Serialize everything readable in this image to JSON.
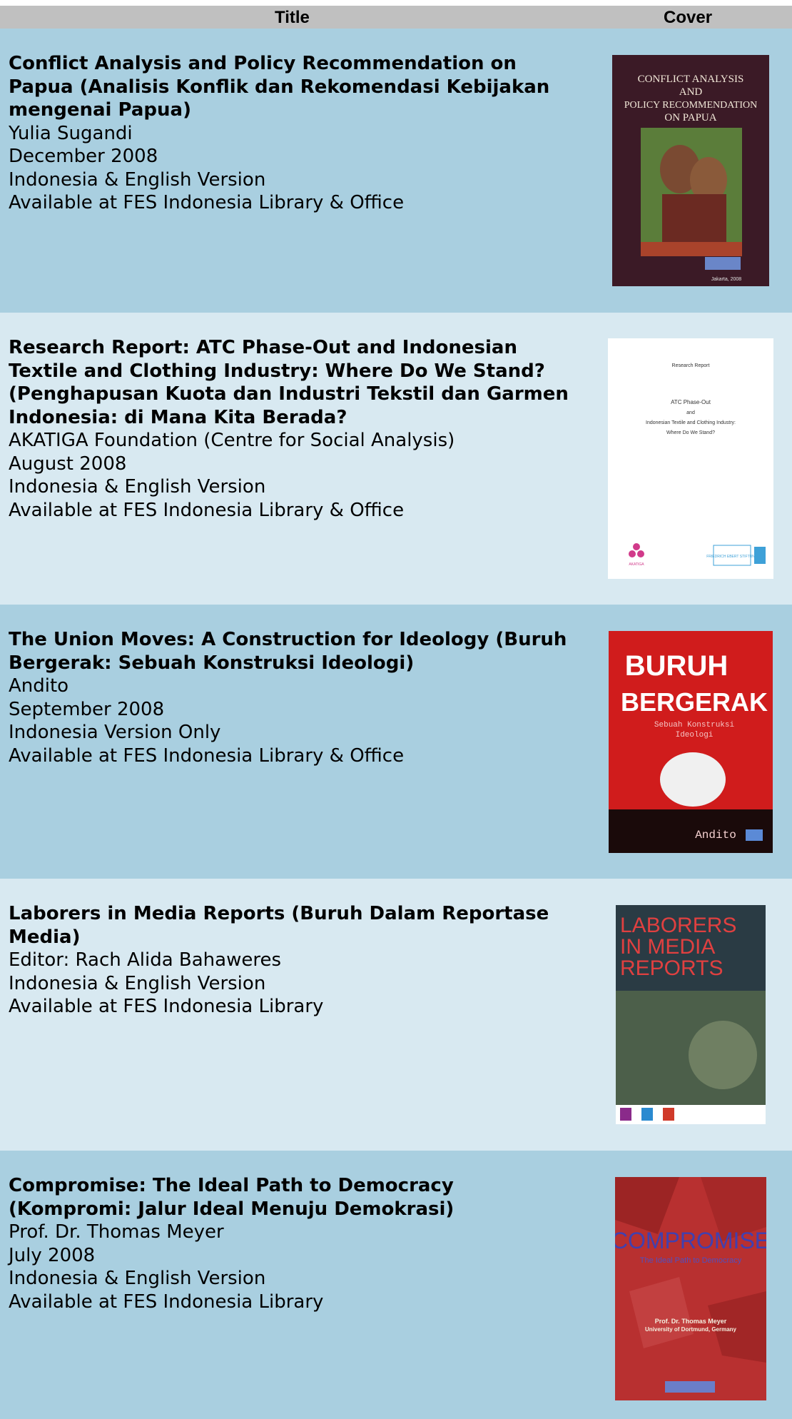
{
  "header": {
    "title": "Title",
    "cover": "Cover"
  },
  "books": [
    {
      "title": "Conflict Analysis and Policy Recommendation on Papua (Analisis Konflik dan Rekomendasi Kebijakan mengenai Papua)",
      "lines": [
        "Yulia Sugandi",
        "December 2008",
        "Indonesia & English Version",
        "Available at FES Indonesia Library & Office"
      ],
      "cover": {
        "line1": "CONFLICT ANALYSIS",
        "line2": "AND",
        "line3": "POLICY RECOMMENDATION",
        "line4": "ON PAPUA",
        "footer": "Jakarta, 2008"
      }
    },
    {
      "title": "Research Report: ATC Phase-Out and Indonesian Textile and Clothing Industry: Where Do We Stand? (Penghapusan Kuota dan Industri Tekstil dan Garmen Indonesia: di Mana Kita Berada?",
      "lines": [
        "AKATIGA Foundation (Centre for Social Analysis)",
        "August 2008",
        "Indonesia & English Version",
        "Available at FES Indonesia Library & Office"
      ],
      "cover": {
        "line1": "Research Report",
        "line2": "ATC Phase-Out",
        "line3": "and",
        "line4": "Indonesian Textile and Clothing Industry:",
        "line5": "Where Do We Stand?",
        "left_logo": "AKATIGA",
        "right_logo": "FRIEDRICH EBERT STIFTUNG"
      }
    },
    {
      "title": "The Union Moves: A Construction for Ideology (Buruh Bergerak: Sebuah Konstruksi Ideologi)",
      "lines": [
        "Andito",
        "September 2008",
        "Indonesia Version Only",
        "Available at FES Indonesia Library & Office"
      ],
      "cover": {
        "line1": "BURUH",
        "line2": "BERGERAK",
        "line3": "Sebuah Konstruksi",
        "line4": "Ideologi",
        "author": "Andito"
      }
    },
    {
      "title": "Laborers in Media Reports (Buruh Dalam Reportase Media)",
      "lines": [
        "Editor: Rach Alida Bahaweres",
        "Indonesia & English Version",
        "Available at FES Indonesia Library"
      ],
      "cover": {
        "line1": "LABORERS",
        "line2": "IN MEDIA",
        "line3": "REPORTS"
      }
    },
    {
      "title": "Compromise: The Ideal Path to Democracy (Kompromi: Jalur Ideal Menuju Demokrasi)",
      "lines": [
        "Prof. Dr. Thomas Meyer",
        "July 2008",
        "Indonesia & English Version",
        "Available at FES Indonesia Library"
      ],
      "cover": {
        "line1": "COMPROMISE",
        "line2": "The Ideal Path to Democracy",
        "line3": "Prof. Dr. Thomas Meyer",
        "line4": "University of Dortmund, Germany"
      }
    }
  ]
}
